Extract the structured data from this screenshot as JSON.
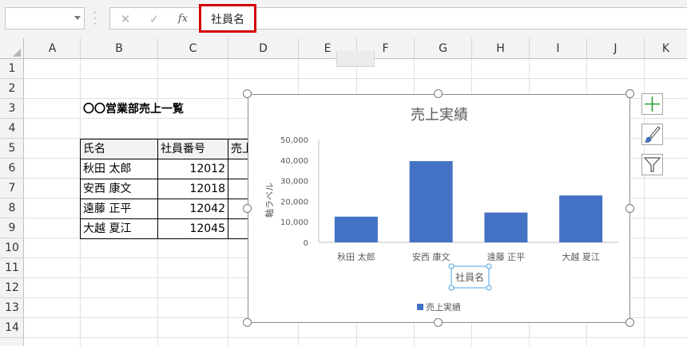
{
  "formula_bar": {
    "name_box_value": "",
    "cancel_glyph": "✕",
    "enter_glyph": "✓",
    "fx_label": "fx",
    "formula_value": "社員名"
  },
  "columns": [
    "A",
    "B",
    "C",
    "D",
    "E",
    "F",
    "G",
    "H",
    "I",
    "J",
    "K"
  ],
  "rows": [
    "1",
    "2",
    "3",
    "4",
    "5",
    "6",
    "7",
    "8",
    "9",
    "10",
    "11",
    "12",
    "13",
    "14"
  ],
  "sheet": {
    "title": "〇〇営業部売上一覧",
    "table": {
      "headers": [
        "氏名",
        "社員番号",
        "売上"
      ],
      "rows": [
        {
          "name": "秋田 太郎",
          "id": "12012"
        },
        {
          "name": "安西 康文",
          "id": "12018"
        },
        {
          "name": "遠藤 正平",
          "id": "12042"
        },
        {
          "name": "大越 夏江",
          "id": "12045"
        }
      ]
    }
  },
  "chart_data": {
    "type": "bar",
    "title": "売上実績",
    "xlabel": "社員名",
    "ylabel": "軸ラベル",
    "categories": [
      "秋田 太郎",
      "安西 康文",
      "遠藤 正平",
      "大越 夏江"
    ],
    "series": [
      {
        "name": "売上実績",
        "values": [
          12500,
          39500,
          14500,
          22800
        ],
        "color": "#4472c4"
      }
    ],
    "ylim": [
      0,
      50000
    ],
    "yticks": [
      0,
      10000,
      20000,
      30000,
      40000,
      50000
    ],
    "ytick_labels": [
      "0",
      "10,000",
      "20,000",
      "30,000",
      "40,000",
      "50,000"
    ],
    "grid": false,
    "legend": "bottom"
  },
  "chart_tools": {
    "elements_icon": "plus-icon",
    "styles_icon": "brush-icon",
    "filter_icon": "filter-icon"
  },
  "colors": {
    "accent_bar": "#4472c4",
    "highlight_red": "#d40000",
    "selection_blue": "#4ea1df"
  }
}
